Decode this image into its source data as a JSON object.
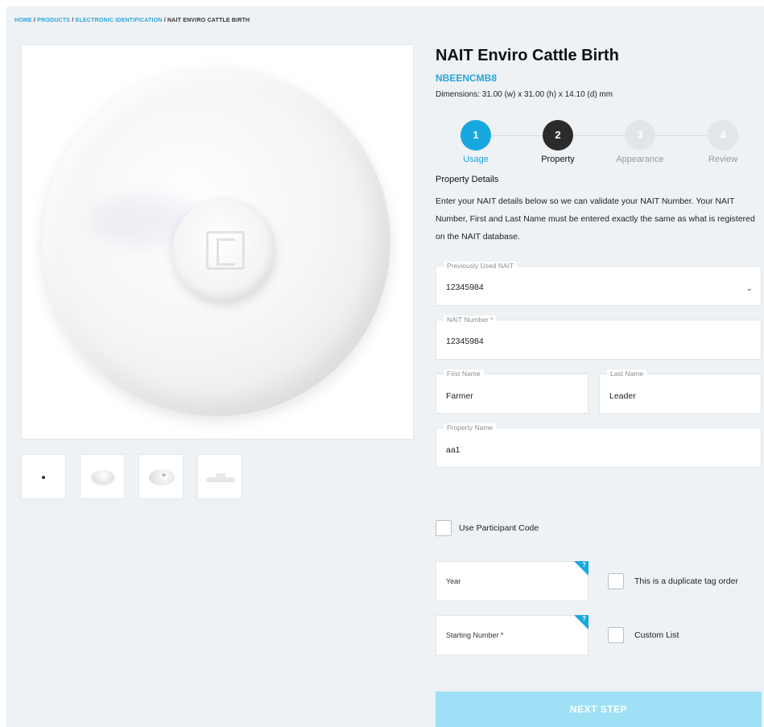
{
  "breadcrumb": {
    "items": [
      "HOME",
      "PRODUCTS",
      "ELECTRONIC IDENTIFICATION"
    ],
    "current": "NAIT ENVIRO CATTLE BIRTH",
    "separator": "/"
  },
  "product": {
    "title": "NAIT Enviro Cattle Birth",
    "sku": "NBEENCMB8",
    "dimensions": "Dimensions: 31.00 (w) x 31.00 (h) x 14.10 (d) mm"
  },
  "stepper": {
    "steps": [
      {
        "number": "1",
        "label": "Usage",
        "state": "complete"
      },
      {
        "number": "2",
        "label": "Property",
        "state": "current"
      },
      {
        "number": "3",
        "label": "Appearance",
        "state": "upcoming"
      },
      {
        "number": "4",
        "label": "Review",
        "state": "upcoming"
      }
    ]
  },
  "form": {
    "section_title": "Property Details",
    "intro": "Enter your NAIT details below so we can validate your NAIT Number. Your NAIT Number, First and Last Name must be entered exactly the same as what is registered on the NAIT database.",
    "previously_used": {
      "label": "Previously Used NAIT",
      "value": "12345984"
    },
    "nait_number": {
      "label": "NAIT Number *",
      "value": "12345984"
    },
    "first_name": {
      "label": "First Name",
      "value": "Farmer"
    },
    "last_name": {
      "label": "Last Name",
      "value": "Leader"
    },
    "property_name": {
      "label": "Property Name",
      "value": "aa1"
    },
    "participant_code_label": "Use Participant Code",
    "year_placeholder": "Year",
    "starting_number_placeholder": "Starting Number *",
    "help_glyph": "?",
    "duplicate_label": "This is a duplicate tag order",
    "custom_list_label": "Custom List",
    "next_label": "NEXT STEP"
  },
  "icons": {
    "dropdown": "chevron-down-icon",
    "help": "help-icon"
  },
  "colors": {
    "accent": "#17a8e0",
    "link": "#2aa4d8",
    "current_step": "#2b2b2b",
    "next_button": "#9fe0f6",
    "page_bg": "#eef2f5"
  }
}
